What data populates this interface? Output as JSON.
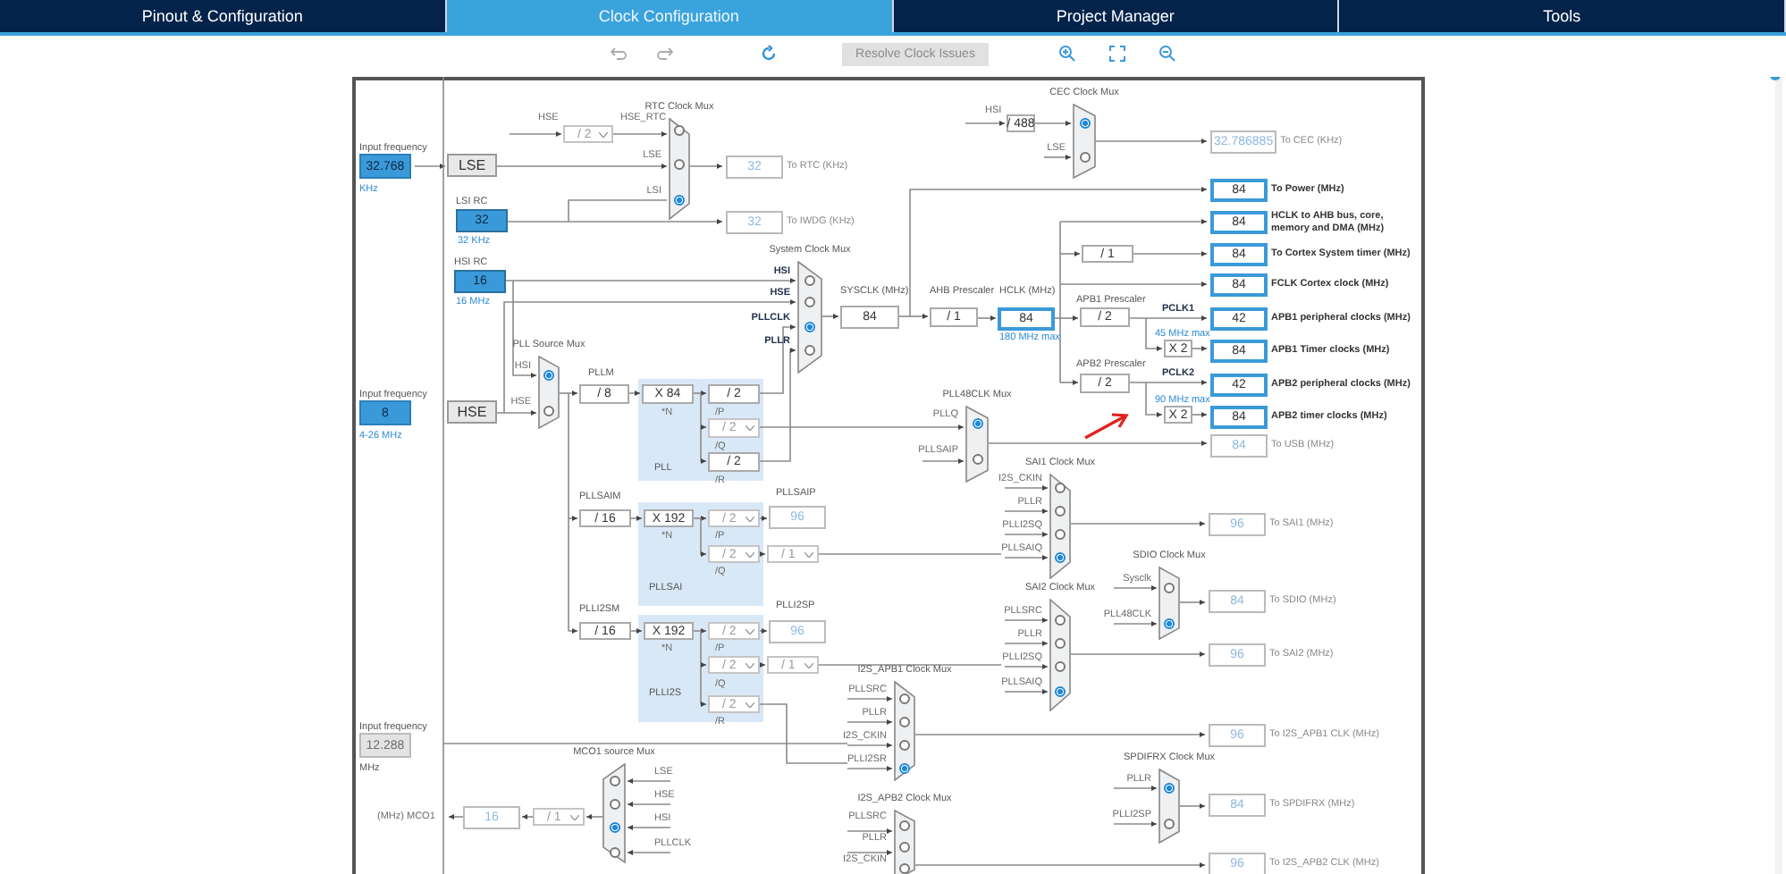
{
  "tabs": [
    {
      "label": "Pinout & Configuration",
      "selected": false
    },
    {
      "label": "Clock Configuration",
      "selected": true
    },
    {
      "label": "Project Manager",
      "selected": false
    },
    {
      "label": "Tools",
      "selected": false
    }
  ],
  "toolbar": {
    "resolve_button": "Resolve Clock Issues"
  },
  "diagram": {
    "inputs": [
      {
        "label": "Input frequency",
        "value": "32.768",
        "unit": "KHz",
        "enabled": true
      },
      {
        "label": "Input frequency",
        "value": "8",
        "unit": "4-26 MHz",
        "enabled": true
      },
      {
        "label": "Input frequency",
        "value": "12.288",
        "unit": "MHz",
        "enabled": false
      }
    ],
    "source_buttons": [
      "LSE",
      "HSE"
    ],
    "oscillators": [
      {
        "label": "LSI RC",
        "value": "32",
        "unit": "32 KHz"
      },
      {
        "label": "HSI RC",
        "value": "16",
        "unit": "16 MHz"
      }
    ],
    "labels": [
      {
        "text": "HSE",
        "kind": "signal"
      },
      {
        "text": "HSE_RTC",
        "kind": "signal"
      },
      {
        "text": "SYSCLK (MHz)",
        "kind": "title"
      },
      {
        "text": "AHB Prescaler",
        "kind": "title"
      },
      {
        "text": "HCLK (MHz)",
        "kind": "title"
      },
      {
        "text": "180 MHz max",
        "kind": "note"
      },
      {
        "text": "APB1 Prescaler",
        "kind": "title"
      },
      {
        "text": "PCLK1",
        "kind": "heading"
      },
      {
        "text": "45 MHz max",
        "kind": "note"
      },
      {
        "text": "APB2 Prescaler",
        "kind": "title"
      },
      {
        "text": "PCLK2",
        "kind": "heading"
      },
      {
        "text": "90 MHz max",
        "kind": "note"
      },
      {
        "text": "HSI",
        "kind": "signal"
      },
      {
        "text": "PLLM",
        "kind": "title"
      },
      {
        "text": "*N",
        "kind": "signal"
      },
      {
        "text": "/P",
        "kind": "signal"
      },
      {
        "text": "/Q",
        "kind": "signal"
      },
      {
        "text": "/R",
        "kind": "signal"
      },
      {
        "text": "PLL",
        "kind": "title"
      },
      {
        "text": "PLLSAIM",
        "kind": "title"
      },
      {
        "text": "*N",
        "kind": "signal"
      },
      {
        "text": "/P",
        "kind": "signal"
      },
      {
        "text": "PLLSAIP",
        "kind": "title"
      },
      {
        "text": "/Q",
        "kind": "signal"
      },
      {
        "text": "PLLSAI",
        "kind": "title"
      },
      {
        "text": "PLLI2SM",
        "kind": "title"
      },
      {
        "text": "*N",
        "kind": "signal"
      },
      {
        "text": "/P",
        "kind": "signal"
      },
      {
        "text": "PLLI2SP",
        "kind": "title"
      },
      {
        "text": "/Q",
        "kind": "signal"
      },
      {
        "text": "PLLI2S",
        "kind": "title"
      },
      {
        "text": "/R",
        "kind": "signal"
      },
      {
        "text": "(MHz) MCO1",
        "kind": "signal"
      }
    ],
    "dividers": [
      {
        "value": "/ 2",
        "select": true,
        "enabled": false
      },
      {
        "value": "/ 488",
        "select": false,
        "enabled": true
      },
      {
        "value": "/ 1",
        "select": false,
        "enabled": true
      },
      {
        "value": "/ 1",
        "select": false,
        "enabled": true
      },
      {
        "value": "/ 2",
        "select": false,
        "enabled": true
      },
      {
        "value": "X 2",
        "select": false,
        "enabled": true
      },
      {
        "value": "/ 2",
        "select": false,
        "enabled": true
      },
      {
        "value": "X 2",
        "select": false,
        "enabled": true
      },
      {
        "value": "/ 8",
        "select": false,
        "enabled": true
      },
      {
        "value": "X 84",
        "select": false,
        "enabled": true
      },
      {
        "value": "/ 2",
        "select": false,
        "enabled": true
      },
      {
        "value": "/ 2",
        "select": true,
        "enabled": false
      },
      {
        "value": "/ 2",
        "select": false,
        "enabled": true
      },
      {
        "value": "/ 16",
        "select": false,
        "enabled": true
      },
      {
        "value": "X 192",
        "select": false,
        "enabled": true
      },
      {
        "value": "/ 2",
        "select": true,
        "enabled": false
      },
      {
        "value": "/ 2",
        "select": true,
        "enabled": false
      },
      {
        "value": "/ 1",
        "select": true,
        "enabled": false
      },
      {
        "value": "/ 16",
        "select": false,
        "enabled": true
      },
      {
        "value": "X 192",
        "select": false,
        "enabled": true
      },
      {
        "value": "/ 2",
        "select": true,
        "enabled": false
      },
      {
        "value": "/ 2",
        "select": true,
        "enabled": false
      },
      {
        "value": "/ 1",
        "select": true,
        "enabled": false
      },
      {
        "value": "/ 2",
        "select": true,
        "enabled": false
      },
      {
        "value": "/ 1",
        "select": true,
        "enabled": false
      },
      {
        "value": "84",
        "select": false,
        "enabled": true
      }
    ],
    "readouts": [
      {
        "value": "32",
        "label": "To RTC (KHz)",
        "enabled": false
      },
      {
        "value": "32",
        "label": "To IWDG (KHz)",
        "enabled": false
      },
      {
        "value": "84",
        "enabled": true
      },
      {
        "value": "32.786885",
        "label": "To CEC (KHz)",
        "enabled": false
      },
      {
        "value": "84",
        "label": "To Power (MHz)",
        "enabled": true
      },
      {
        "value": "84",
        "label": "HCLK to AHB bus, core, memory and DMA (MHz)",
        "enabled": true
      },
      {
        "value": "84",
        "label": "To Cortex System timer (MHz)",
        "enabled": true
      },
      {
        "value": "84",
        "label": "FCLK Cortex clock (MHz)",
        "enabled": true
      },
      {
        "value": "42",
        "label": "APB1 peripheral clocks (MHz)",
        "enabled": true
      },
      {
        "value": "84",
        "label": "APB1 Timer clocks (MHz)",
        "enabled": true
      },
      {
        "value": "42",
        "label": "APB2 peripheral clocks (MHz)",
        "enabled": true
      },
      {
        "value": "84",
        "label": "APB2 timer clocks (MHz)",
        "enabled": true
      },
      {
        "value": "84",
        "label": "To USB (MHz)",
        "enabled": false
      },
      {
        "value": "96",
        "enabled": false
      },
      {
        "value": "96",
        "enabled": false
      },
      {
        "value": "96",
        "label": "To SAI1 (MHz)",
        "enabled": false
      },
      {
        "value": "84",
        "label": "To SDIO (MHz)",
        "enabled": false
      },
      {
        "value": "96",
        "label": "To SAI2 (MHz)",
        "enabled": false
      },
      {
        "value": "96",
        "label": "To I2S_APB1 CLK (MHz)",
        "enabled": false
      },
      {
        "value": "84",
        "label": "To SPDIFRX (MHz)",
        "enabled": false
      },
      {
        "value": "96",
        "label": "To I2S_APB2 CLK (MHz)",
        "enabled": false
      },
      {
        "value": "16",
        "enabled": false
      }
    ],
    "muxes": [
      {
        "title": "RTC Clock Mux",
        "inputs": [
          {
            "selected": false
          },
          {
            "label": "LSE",
            "selected": false
          },
          {
            "label": "LSI",
            "selected": true
          }
        ]
      },
      {
        "title": "System Clock Mux",
        "inputs": [
          {
            "label": "HSI",
            "selected": false
          },
          {
            "label": "HSE",
            "selected": false
          },
          {
            "label": "PLLCLK",
            "selected": true
          },
          {
            "label": "PLLR",
            "selected": false
          }
        ]
      },
      {
        "title": "PLL Source Mux",
        "inputs": [
          {
            "label": "HSI",
            "selected": true
          },
          {
            "label": "HSE",
            "selected": false
          }
        ]
      },
      {
        "title": "CEC Clock Mux",
        "inputs": [
          {
            "selected": true
          },
          {
            "label": "LSE",
            "selected": false
          }
        ]
      },
      {
        "title": "PLL48CLK Mux",
        "inputs": [
          {
            "label": "PLLQ",
            "selected": true
          },
          {
            "label": "PLLSAIP",
            "selected": false
          }
        ]
      },
      {
        "title": "SAI1 Clock Mux",
        "inputs": [
          {
            "label": "I2S_CKIN",
            "selected": false
          },
          {
            "label": "PLLR",
            "selected": false
          },
          {
            "label": "PLLI2SQ",
            "selected": false
          },
          {
            "label": "PLLSAIQ",
            "selected": true
          }
        ]
      },
      {
        "title": "SDIO Clock Mux",
        "inputs": [
          {
            "label": "Sysclk",
            "selected": false
          },
          {
            "label": "PLL48CLK",
            "selected": true
          }
        ]
      },
      {
        "title": "SAI2 Clock Mux",
        "inputs": [
          {
            "label": "PLLSRC",
            "selected": false
          },
          {
            "label": "PLLR",
            "selected": false
          },
          {
            "label": "PLLI2SQ",
            "selected": false
          },
          {
            "label": "PLLSAIQ",
            "selected": true
          }
        ]
      },
      {
        "title": "I2S_APB1 Clock Mux",
        "inputs": [
          {
            "label": "PLLSRC",
            "selected": false
          },
          {
            "label": "PLLR",
            "selected": false
          },
          {
            "label": "I2S_CKIN",
            "selected": false
          },
          {
            "label": "PLLI2SR",
            "selected": true
          }
        ]
      },
      {
        "title": "SPDIFRX Clock Mux",
        "inputs": [
          {
            "label": "PLLR",
            "selected": true
          },
          {
            "label": "PLLI2SP",
            "selected": false
          }
        ]
      },
      {
        "title": "I2S_APB2 Clock Mux",
        "inputs": [
          {
            "label": "PLLSRC",
            "selected": false
          },
          {
            "label": "PLLR",
            "selected": false
          },
          {
            "label": "I2S_CKIN",
            "selected": false
          }
        ]
      },
      {
        "title": "MCO1 source Mux",
        "inputs": [
          {
            "label": "LSE",
            "selected": false
          },
          {
            "label": "HSE",
            "selected": false
          },
          {
            "label": "HSI",
            "selected": true
          },
          {
            "label": "PLLCLK",
            "selected": false
          }
        ]
      }
    ]
  }
}
